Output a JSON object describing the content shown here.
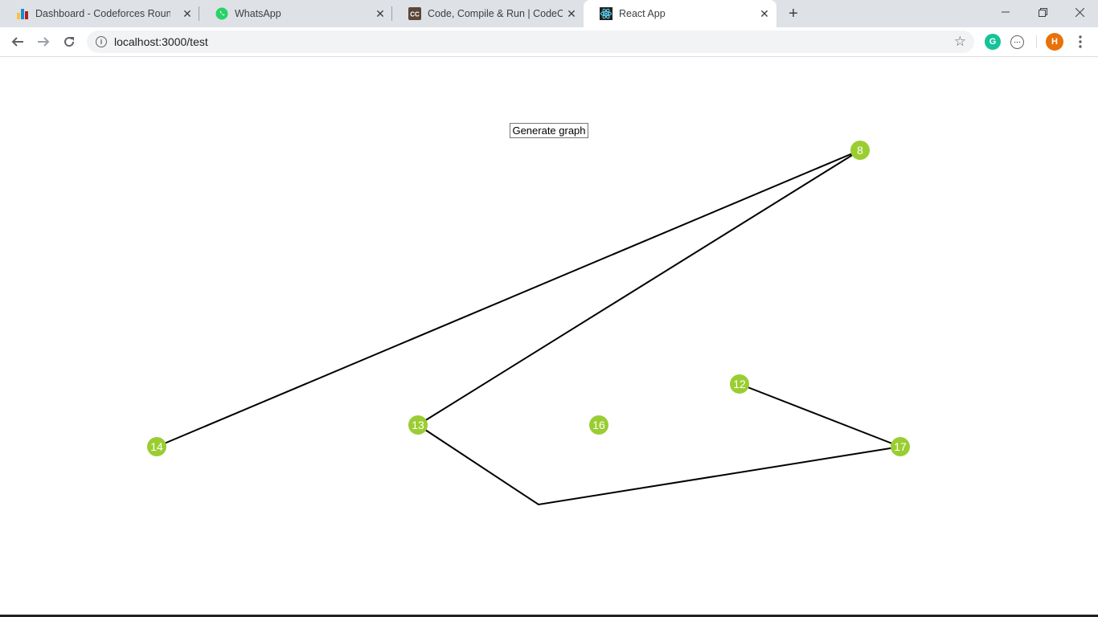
{
  "browser": {
    "tabs": [
      {
        "title": "Dashboard - Codeforces Round #",
        "icon": "codeforces-icon"
      },
      {
        "title": "WhatsApp",
        "icon": "whatsapp-icon"
      },
      {
        "title": "Code, Compile & Run | CodeChef",
        "icon": "codechef-icon"
      },
      {
        "title": "React App",
        "icon": "react-icon",
        "active": true
      }
    ],
    "url": "localhost:3000/test",
    "profile_initial": "H",
    "colors": {
      "tabbar": "#dee1e6",
      "profile": "#e8710a",
      "grammarly": "#15c39a"
    }
  },
  "page": {
    "generate_button_label": "Generate graph"
  },
  "graph": {
    "node_color": "#9acd32",
    "nodes": [
      {
        "id": "8",
        "label": "8"
      },
      {
        "id": "12",
        "label": "12"
      },
      {
        "id": "13",
        "label": "13"
      },
      {
        "id": "14",
        "label": "14"
      },
      {
        "id": "16",
        "label": "16"
      },
      {
        "id": "17",
        "label": "17"
      }
    ],
    "edges": [
      {
        "from": "8",
        "to": "14"
      },
      {
        "from": "8",
        "to": "13"
      },
      {
        "from": "13",
        "to": "17"
      },
      {
        "from": "12",
        "to": "17"
      }
    ]
  }
}
